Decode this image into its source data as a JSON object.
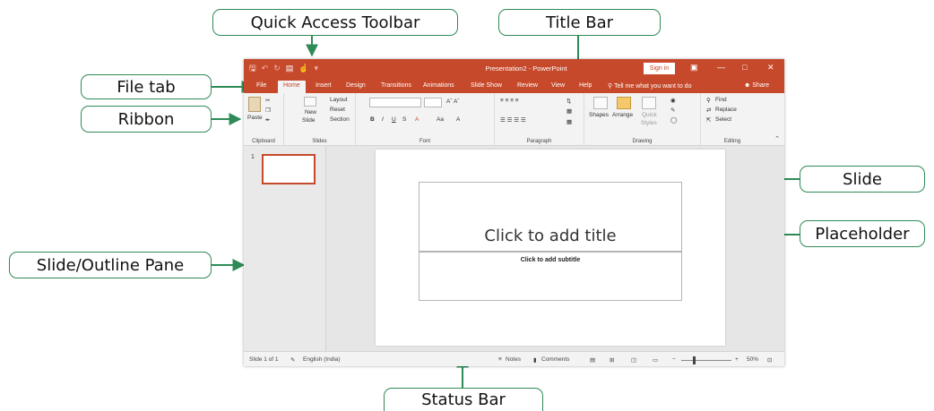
{
  "callouts": {
    "quick_access_toolbar": "Quick Access Toolbar",
    "title_bar": "Title Bar",
    "file_tab": "File tab",
    "ribbon": "Ribbon",
    "slide": "Slide",
    "placeholder": "Placeholder",
    "slide_outline_pane": "Slide/Outline Pane",
    "status_bar": "Status Bar"
  },
  "window": {
    "title": "Presentation2 - PowerPoint",
    "sign_in": "Sign in",
    "accent_color": "#c6492b"
  },
  "tabs": [
    {
      "label": "File"
    },
    {
      "label": "Home"
    },
    {
      "label": "Insert"
    },
    {
      "label": "Design"
    },
    {
      "label": "Transitions"
    },
    {
      "label": "Animations"
    },
    {
      "label": "Slide Show"
    },
    {
      "label": "Review"
    },
    {
      "label": "View"
    },
    {
      "label": "Help"
    }
  ],
  "tell_me": "Tell me what you want to do",
  "share": "Share",
  "ribbon": {
    "clipboard": {
      "paste": "Paste",
      "label": "Clipboard"
    },
    "slides": {
      "new_slide_1": "New",
      "new_slide_2": "Slide",
      "layout": "Layout",
      "reset": "Reset",
      "section": "Section",
      "label": "Slides"
    },
    "font": {
      "label": "Font"
    },
    "paragraph": {
      "label": "Paragraph"
    },
    "drawing": {
      "shapes": "Shapes",
      "arrange": "Arrange",
      "quick_styles_1": "Quick",
      "quick_styles_2": "Styles",
      "label": "Drawing"
    },
    "editing": {
      "find": "Find",
      "replace": "Replace",
      "select": "Select",
      "label": "Editing"
    }
  },
  "thumbnail": {
    "number": "1"
  },
  "slide": {
    "title_placeholder": "Click to add title",
    "subtitle_placeholder": "Click to add subtitle"
  },
  "status": {
    "slide_count": "Slide 1 of 1",
    "language": "English (India)",
    "notes": "Notes",
    "comments": "Comments",
    "zoom": "50%"
  }
}
